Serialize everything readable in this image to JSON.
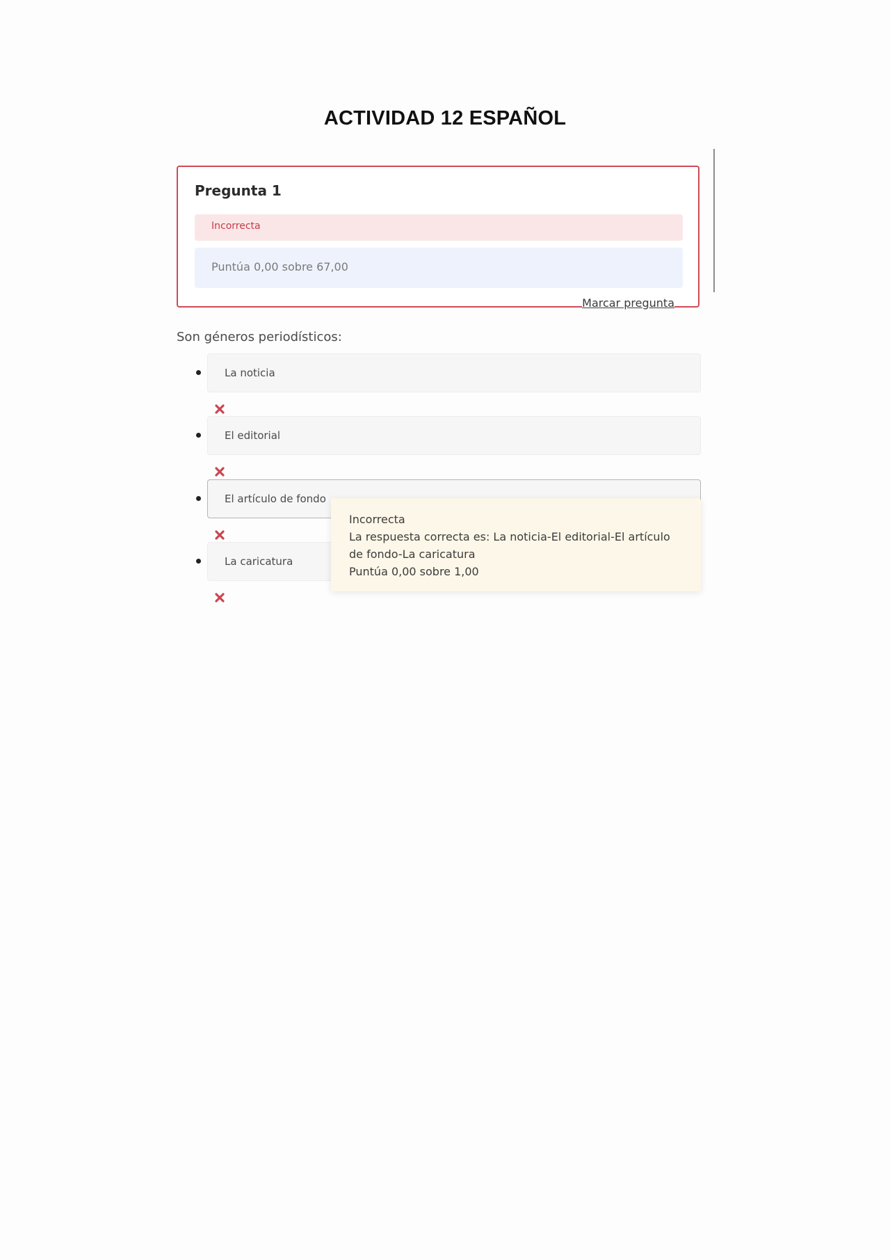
{
  "document": {
    "title": "ACTIVIDAD 12 ESPAÑOL"
  },
  "question": {
    "title": "Pregunta 1",
    "state": "Incorrecta",
    "grade": "Puntúa 0,00 sobre 67,00",
    "flag_label": "Marcar pregunta",
    "text": "Son géneros periodísticos:",
    "answers": [
      {
        "label": "La noticia",
        "icon": "incorrect-x-icon"
      },
      {
        "label": "El editorial",
        "icon": "incorrect-x-icon"
      },
      {
        "label": "El artículo de fondo",
        "icon": "incorrect-x-icon"
      },
      {
        "label": "La caricatura",
        "icon": "incorrect-x-icon"
      }
    ]
  },
  "feedback": {
    "state": "Incorrecta",
    "correct_answer": "La respuesta correcta es: La noticia-El editorial-El artículo de fondo-La caricatura",
    "grade": "Puntúa 0,00 sobre 1,00"
  },
  "colors": {
    "card_border": "#cf4a55",
    "incorrect_bg": "#fbe6e7",
    "incorrect_text": "#c23d49",
    "grade_bg": "#eef2fc",
    "tooltip_bg": "#fcf7e8",
    "x_icon": "#c9474f"
  }
}
